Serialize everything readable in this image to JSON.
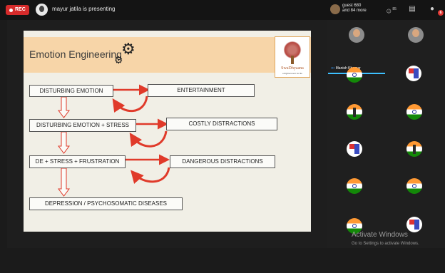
{
  "topbar": {
    "rec_label": "REC",
    "presenter_text": "mayur jatila is presenting",
    "guest_line1": "guest 680",
    "guest_line2": "and 84 more",
    "people_count": "85",
    "badge_count": "6",
    "colors": {
      "rec": "#d62b2b",
      "badge": "#e53935"
    }
  },
  "slide": {
    "title": "Emotion Engineering",
    "logo_text": "SwaDhyaana",
    "logo_sub": "enlightenment for life",
    "boxes": {
      "disturbing_emotion": "DISTURBING EMOTION",
      "entertainment": "ENTERTAINMENT",
      "de_stress": "DISTURBING EMOTION + STRESS",
      "costly_distractions": "COSTLY DISTRACTIONS",
      "de_stress_frustration": "DE + STRESS + FRUSTRATION",
      "dangerous_distractions": "DANGEROUS DISTRACTIONS",
      "depression": "DEPRESSION / PSYCHOSOMATIC DISEASES"
    },
    "colors": {
      "header": "#f7d5a8",
      "arrow": "#e03a2a",
      "background": "#f1efe6"
    }
  },
  "participants": {
    "active_name": "Manish Khemar"
  },
  "watermark": {
    "line1": "Activate Windows",
    "line2": "Go to Settings to activate Windows."
  }
}
